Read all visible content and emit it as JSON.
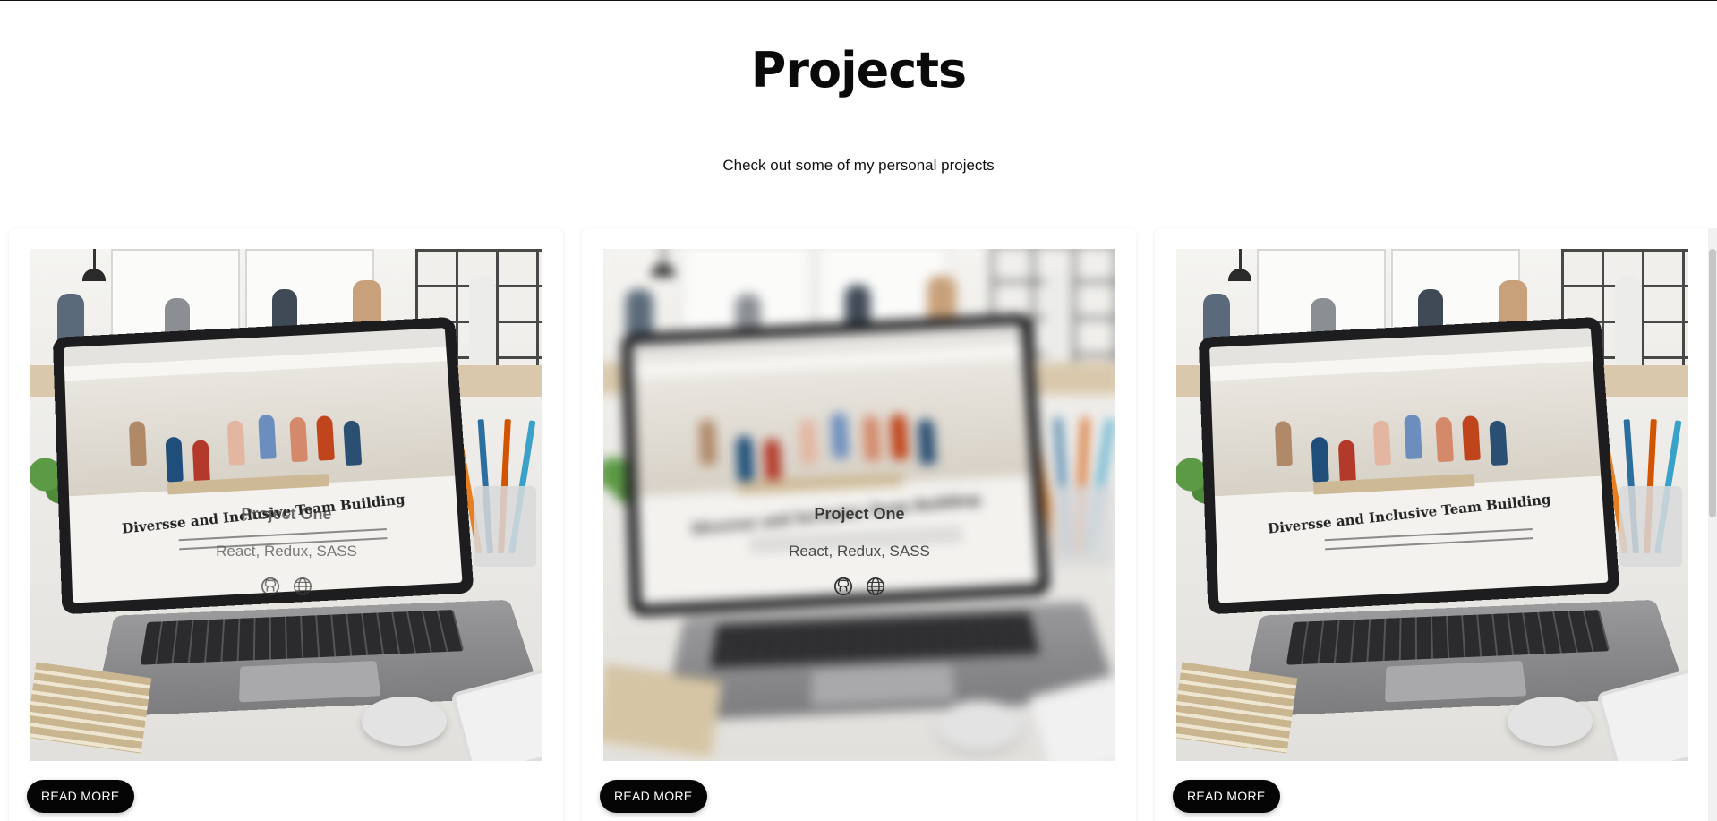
{
  "header": {
    "title": "Projects",
    "subtitle": "Check out some of my personal projects"
  },
  "projects": [
    {
      "overlay_title": "Project One",
      "overlay_tech": "React, Redux, SASS",
      "image_caption": "Diversse and Inclusive Team Building",
      "button_label": "READ MORE",
      "state": "partial-overlay"
    },
    {
      "overlay_title": "Project One",
      "overlay_tech": "React, Redux, SASS",
      "image_caption": "Diversse and Inclusive Team Building",
      "button_label": "READ MORE",
      "state": "hover-blurred"
    },
    {
      "overlay_title": "",
      "overlay_tech": "",
      "image_caption": "Diversse and Inclusive Team Building",
      "button_label": "READ MORE",
      "state": "default"
    }
  ],
  "icons": {
    "github": "github-icon",
    "website": "globe-icon"
  },
  "colors": {
    "button_bg": "#050505",
    "button_text": "#ffffff",
    "title": "#0a0a0a"
  }
}
